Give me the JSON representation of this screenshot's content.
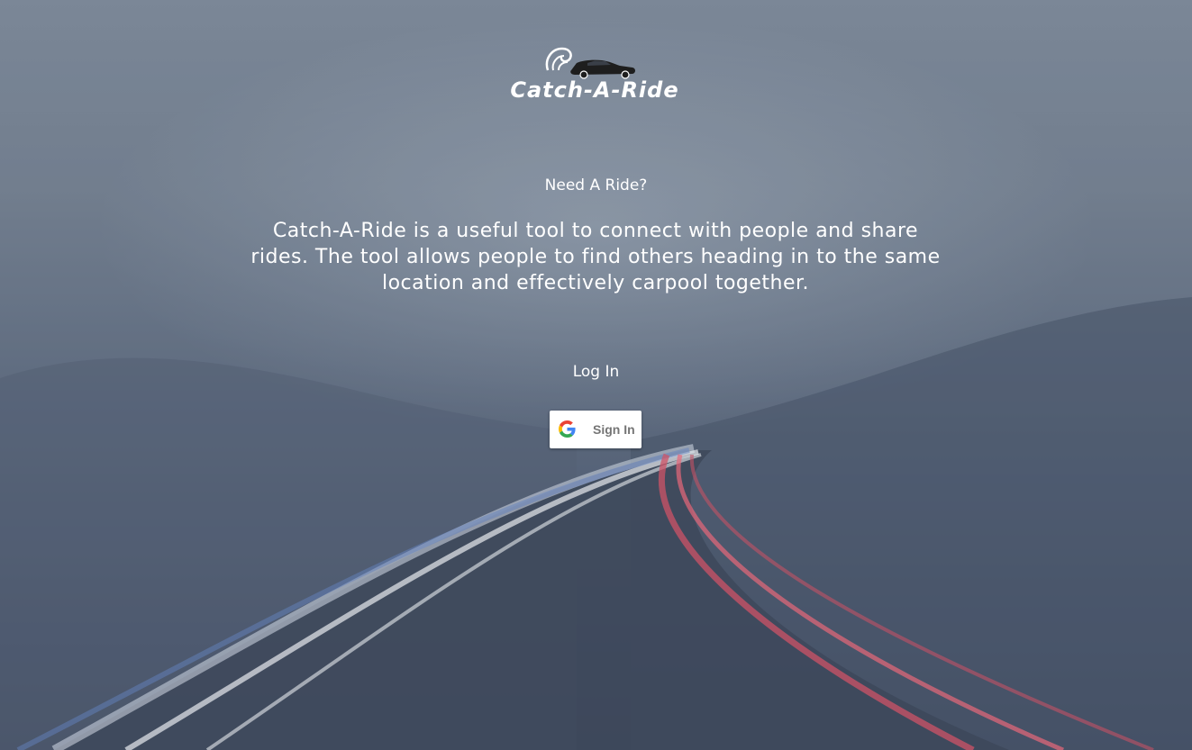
{
  "brand": {
    "name": "Catch-A-Ride"
  },
  "hero": {
    "tagline": "Need A Ride?",
    "description": "Catch-A-Ride is a useful tool to connect with people and share rides. The tool allows people to find others heading in to the same location and effectively carpool together."
  },
  "login": {
    "heading": "Log In",
    "google_button_label": "Sign In"
  },
  "colors": {
    "background_top": "#7a8594",
    "background_bottom": "#333d52",
    "text": "#ffffff",
    "button_bg": "#ffffff",
    "button_text": "#757575",
    "google_blue": "#4285F4",
    "google_red": "#EA4335",
    "google_yellow": "#FBBC05",
    "google_green": "#34A853"
  },
  "icons": {
    "logo": "car-with-wave-logo",
    "google": "google-g-icon"
  }
}
